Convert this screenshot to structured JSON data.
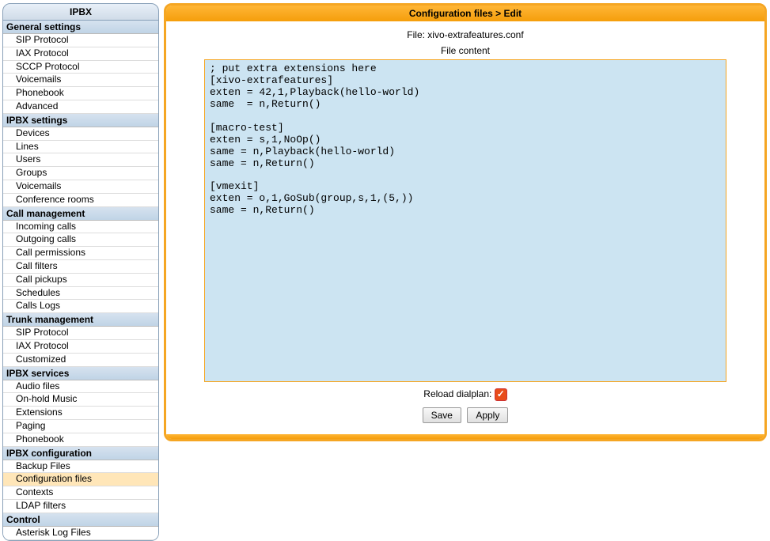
{
  "sidebar": {
    "title": "IPBX",
    "sections": [
      {
        "header": "General settings",
        "items": [
          "SIP Protocol",
          "IAX Protocol",
          "SCCP Protocol",
          "Voicemails",
          "Phonebook",
          "Advanced"
        ]
      },
      {
        "header": "IPBX settings",
        "items": [
          "Devices",
          "Lines",
          "Users",
          "Groups",
          "Voicemails",
          "Conference rooms"
        ]
      },
      {
        "header": "Call management",
        "items": [
          "Incoming calls",
          "Outgoing calls",
          "Call permissions",
          "Call filters",
          "Call pickups",
          "Schedules",
          "Calls Logs"
        ]
      },
      {
        "header": "Trunk management",
        "items": [
          "SIP Protocol",
          "IAX Protocol",
          "Customized"
        ]
      },
      {
        "header": "IPBX services",
        "items": [
          "Audio files",
          "On-hold Music",
          "Extensions",
          "Paging",
          "Phonebook"
        ]
      },
      {
        "header": "IPBX configuration",
        "items": [
          "Backup Files",
          "Configuration files",
          "Contexts",
          "LDAP filters"
        ],
        "active": "Configuration files"
      },
      {
        "header": "Control",
        "items": [
          "Asterisk Log Files"
        ]
      }
    ]
  },
  "main": {
    "breadcrumb": "Configuration files > Edit",
    "file_label": "File: xivo-extrafeatures.conf",
    "content_label": "File content",
    "editor_value": "; put extra extensions here\n[xivo-extrafeatures]\nexten = 42,1,Playback(hello-world)\nsame  = n,Return()\n\n[macro-test]\nexten = s,1,NoOp()\nsame = n,Playback(hello-world)\nsame = n,Return()\n\n[vmexit]\nexten = o,1,GoSub(group,s,1,(5,))\nsame = n,Return()\n",
    "reload_label": "Reload dialplan:",
    "reload_checked": true,
    "save_label": "Save",
    "apply_label": "Apply"
  }
}
